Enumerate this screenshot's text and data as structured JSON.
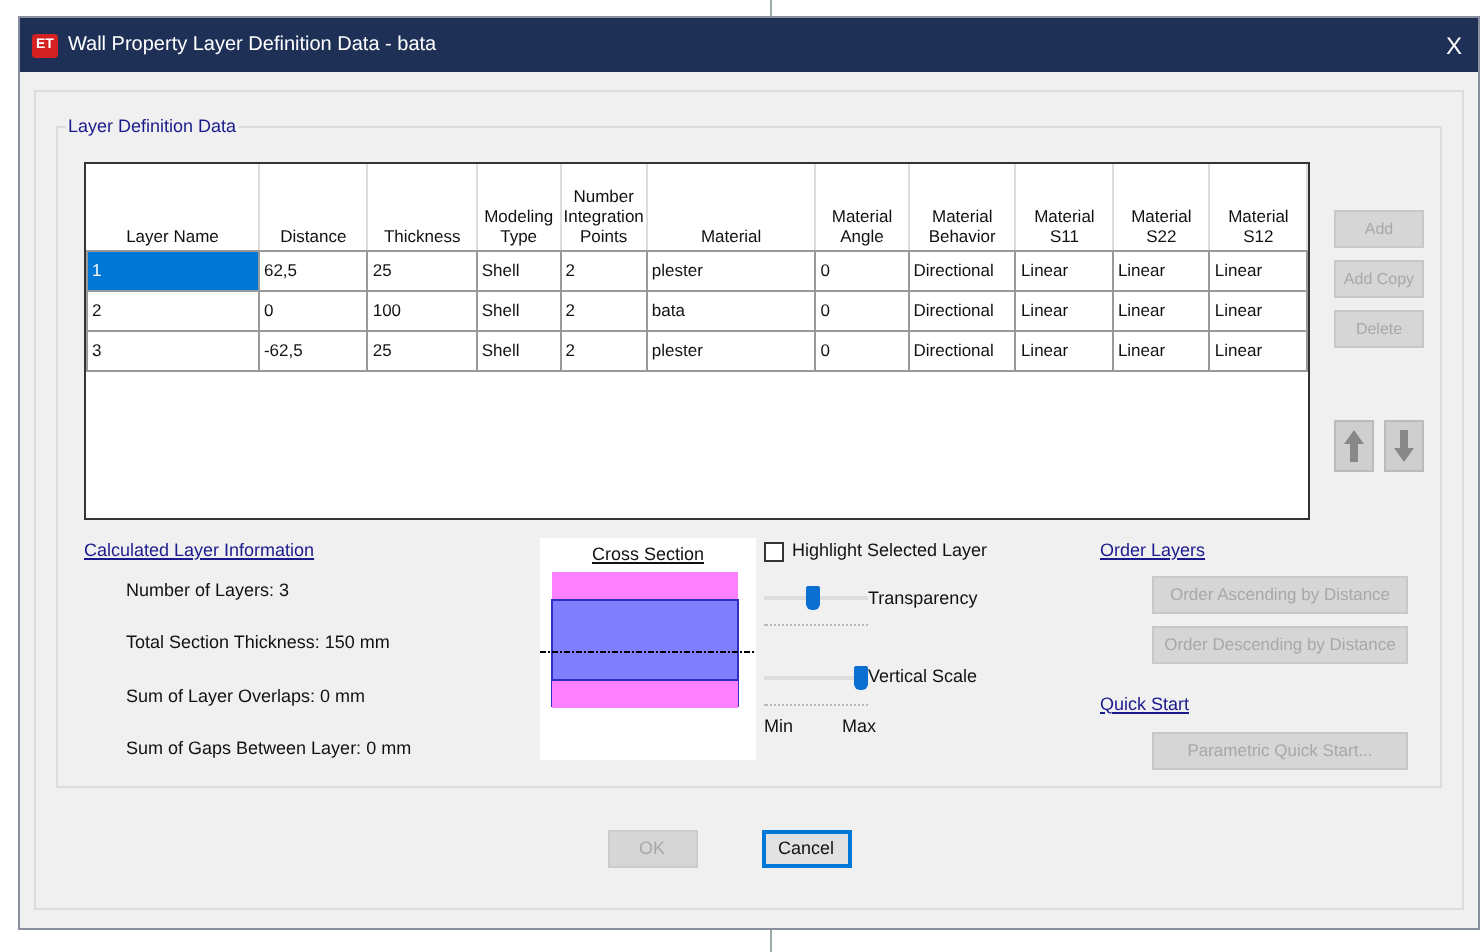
{
  "window": {
    "app_badge": "ET",
    "title": "Wall Property Layer Definition Data - bata",
    "close": "X"
  },
  "group_title": "Layer Definition Data",
  "table": {
    "columns": [
      "Layer Name",
      "Distance",
      "Thickness",
      "Modeling Type",
      "Number Integration Points",
      "Material",
      "Material Angle",
      "Material Behavior",
      "Material S11",
      "Material S22",
      "Material S12"
    ],
    "rows": [
      {
        "selected": true,
        "cells": [
          "1",
          "62,5",
          "25",
          "Shell",
          "2",
          "plester",
          "0",
          "Directional",
          "Linear",
          "Linear",
          "Linear"
        ]
      },
      {
        "selected": false,
        "cells": [
          "2",
          "0",
          "100",
          "Shell",
          "2",
          "bata",
          "0",
          "Directional",
          "Linear",
          "Linear",
          "Linear"
        ]
      },
      {
        "selected": false,
        "cells": [
          "3",
          "-62,5",
          "25",
          "Shell",
          "2",
          "plester",
          "0",
          "Directional",
          "Linear",
          "Linear",
          "Linear"
        ]
      }
    ]
  },
  "side_buttons": [
    {
      "label": "Add",
      "disabled": true
    },
    {
      "label": "Add Copy",
      "disabled": true
    },
    {
      "label": "Delete",
      "disabled": true
    }
  ],
  "calculated_info": {
    "title": "Calculated Layer Information",
    "lines": [
      "Number of Layers:  3",
      "Total Section Thickness:  150 mm",
      "Sum of Layer Overlaps:  0 mm",
      "Sum of Gaps Between Layer:  0 mm"
    ]
  },
  "cross_section": {
    "title": "Cross Section"
  },
  "highlight_selected_layer": {
    "label": "Highlight Selected Layer",
    "checked": false
  },
  "sliders": [
    {
      "label": "Transparency",
      "level": 0.46
    },
    {
      "label": "Vertical Scale",
      "level": 0.92
    }
  ],
  "slider_min": "Min",
  "slider_max": "Max",
  "order_layers": {
    "title": "Order Layers",
    "buttons": [
      {
        "label": "Order Ascending by Distance",
        "disabled": true
      },
      {
        "label": "Order Descending by Distance",
        "disabled": true
      }
    ]
  },
  "quick_start": {
    "title": "Quick Start",
    "buttons": [
      {
        "label": "Parametric Quick Start...",
        "disabled": true
      }
    ]
  },
  "footer_buttons": [
    {
      "label": "OK",
      "disabled": true
    },
    {
      "label": "Cancel",
      "disabled": false
    }
  ]
}
